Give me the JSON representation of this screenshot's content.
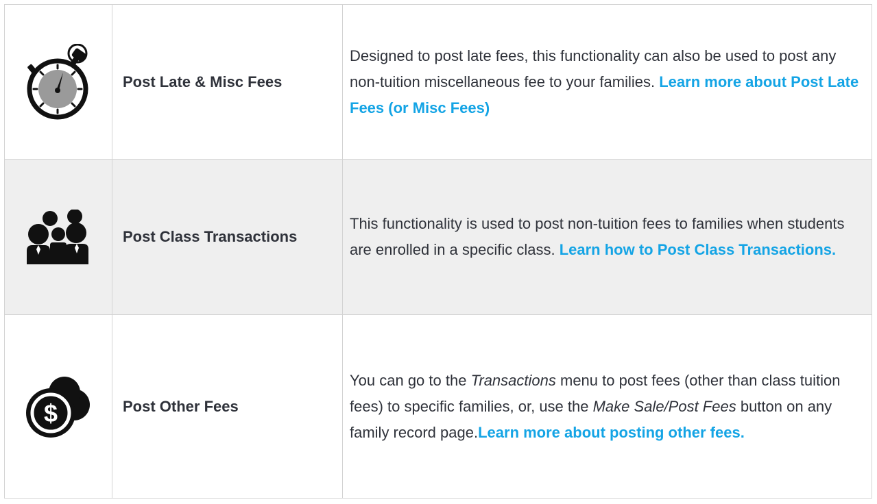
{
  "rows": [
    {
      "icon": "stopwatch-icon",
      "name": "Post Late & Misc Fees",
      "desc_text": "Designed to post late fees, this functionality can also be used to post any non-tuition miscellaneous fee to your families. ",
      "link": "Learn more about Post Late Fees (or Misc Fees)"
    },
    {
      "icon": "people-group-icon",
      "name": "Post Class Transactions",
      "desc_text": "This functionality is used to post non-tuition fees to families when students are enrolled in a specific class. ",
      "link": "Learn how to Post Class Transactions."
    },
    {
      "icon": "coins-dollar-icon",
      "name": "Post Other Fees",
      "desc_pre": "You can go to the ",
      "desc_em1": "Transactions",
      "desc_mid": " menu to post fees (other than class tuition fees) to specific families, or, use the ",
      "desc_em2": "Make Sale/Post Fees",
      "desc_post": " button on any family record page.",
      "link": "Learn more about posting other fees."
    }
  ],
  "colors": {
    "link": "#14a4e5",
    "text": "#2f323a",
    "border": "#d3d3d3",
    "shaded_row": "#efefef"
  }
}
